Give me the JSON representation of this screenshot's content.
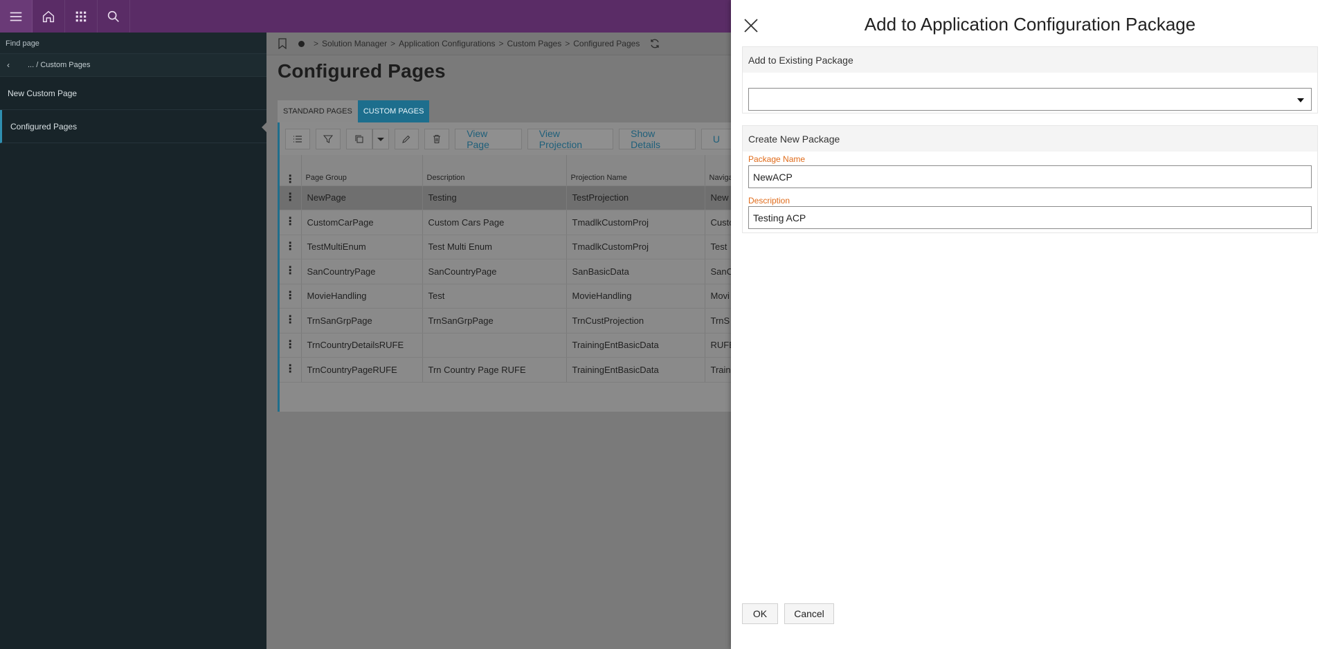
{
  "sidebar": {
    "find_placeholder": "Find page",
    "breadcrumb": "... / Custom Pages",
    "items": [
      {
        "label": "New Custom Page"
      },
      {
        "label": "Configured Pages"
      }
    ]
  },
  "breadcrumb": {
    "items": [
      "Solution Manager",
      "Application Configurations",
      "Custom Pages",
      "Configured Pages"
    ],
    "separator": ">"
  },
  "main": {
    "title": "Configured Pages",
    "tabs": [
      {
        "label": "STANDARD PAGES",
        "active": false
      },
      {
        "label": "CUSTOM PAGES",
        "active": true
      }
    ],
    "toolbar": {
      "view_page": "View Page",
      "view_projection": "View Projection",
      "show_details": "Show Details",
      "truncated": "U"
    },
    "table": {
      "columns": [
        "Page Group",
        "Description",
        "Projection Name",
        "Navigat"
      ],
      "rows": [
        [
          "NewPage",
          "Testing",
          "TestProjection",
          "New"
        ],
        [
          "CustomCarPage",
          "Custom Cars Page",
          "TmadlkCustomProj",
          "Custo"
        ],
        [
          "TestMultiEnum",
          "Test Multi Enum",
          "TmadlkCustomProj",
          "Test "
        ],
        [
          "SanCountryPage",
          "SanCountryPage",
          "SanBasicData",
          "SanC"
        ],
        [
          "MovieHandling",
          "Test",
          "MovieHandling",
          "Movi"
        ],
        [
          "TrnSanGrpPage",
          "TrnSanGrpPage",
          "TrnCustProjection",
          "TrnS"
        ],
        [
          "TrnCountryDetailsRUFE",
          "",
          "TrainingEntBasicData",
          "RUFE"
        ],
        [
          "TrnCountryPageRUFE",
          "Trn Country Page RUFE",
          "TrainingEntBasicData",
          "Train"
        ]
      ]
    }
  },
  "dialog": {
    "title": "Add to Application Configuration Package",
    "existing_group": "Add to Existing Package",
    "existing_value": "",
    "new_group": "Create New Package",
    "package_name_label": "Package Name",
    "package_name_value": "NewACP",
    "description_label": "Description",
    "description_value": "Testing ACP",
    "ok": "OK",
    "cancel": "Cancel"
  },
  "colors": {
    "topbar": "#5a2c66",
    "sidebar": "#182429",
    "accent": "#1d6e8d",
    "required_label": "#e06b1a"
  },
  "icons": [
    "menu-icon",
    "home-icon",
    "apps-grid-icon",
    "search-icon",
    "bookmark-icon",
    "refresh-icon",
    "close-icon",
    "chevron-down-icon"
  ]
}
